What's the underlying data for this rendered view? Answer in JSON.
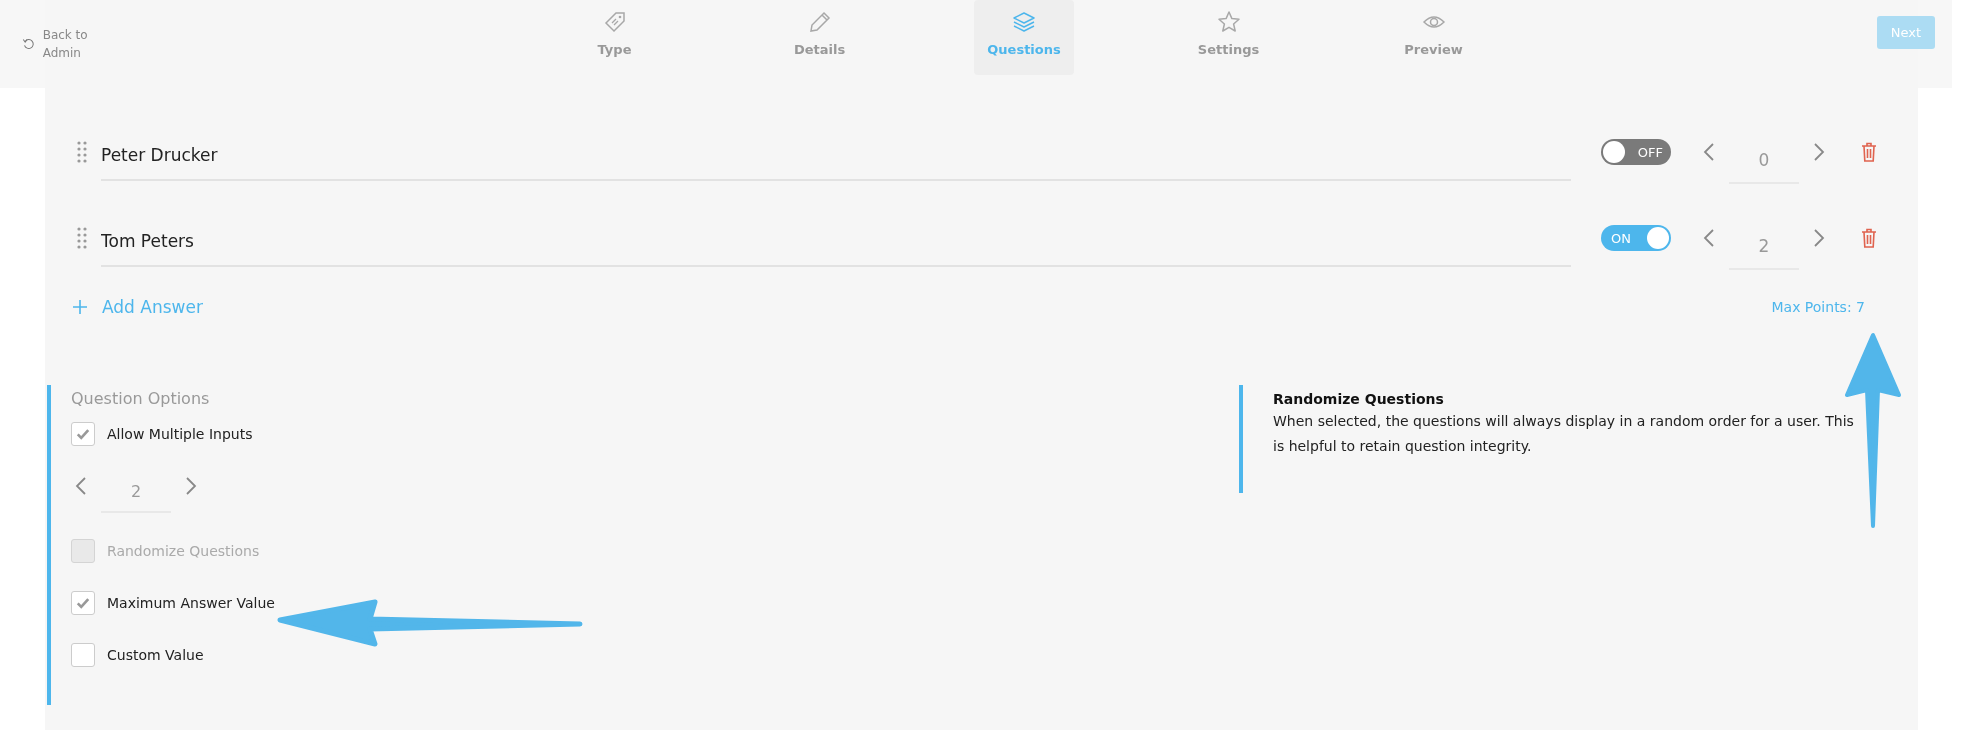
{
  "header": {
    "back_label": "Back to Admin",
    "tabs": [
      {
        "label": "Type",
        "selected": false
      },
      {
        "label": "Details",
        "selected": false
      },
      {
        "label": "Questions",
        "selected": true
      },
      {
        "label": "Settings",
        "selected": false
      },
      {
        "label": "Preview",
        "selected": false
      }
    ],
    "next_button": "Next"
  },
  "answers": [
    {
      "text": "Peter Drucker",
      "on": false,
      "toggle_label": "OFF",
      "points": "0"
    },
    {
      "text": "Tom Peters",
      "on": true,
      "toggle_label": "ON",
      "points": "2"
    }
  ],
  "add_answer": "Add Answer",
  "max_points": "Max Points: 7",
  "question_options": {
    "title": "Question Options",
    "options": [
      {
        "kind": "checkbox",
        "label": "Allow Multiple Inputs",
        "checked": true,
        "disabled": false
      },
      {
        "kind": "stepper",
        "value": "2"
      },
      {
        "kind": "checkbox",
        "label": "Randomize Questions",
        "checked": false,
        "disabled": true
      },
      {
        "kind": "checkbox",
        "label": "Maximum Answer Value",
        "checked": true,
        "disabled": false
      },
      {
        "kind": "checkbox",
        "label": "Custom Value",
        "checked": false,
        "disabled": false
      }
    ]
  },
  "help": {
    "title": "Randomize Questions",
    "text": "When selected, the questions will always display in a random order for a user. This is helpful to retain question integrity."
  }
}
